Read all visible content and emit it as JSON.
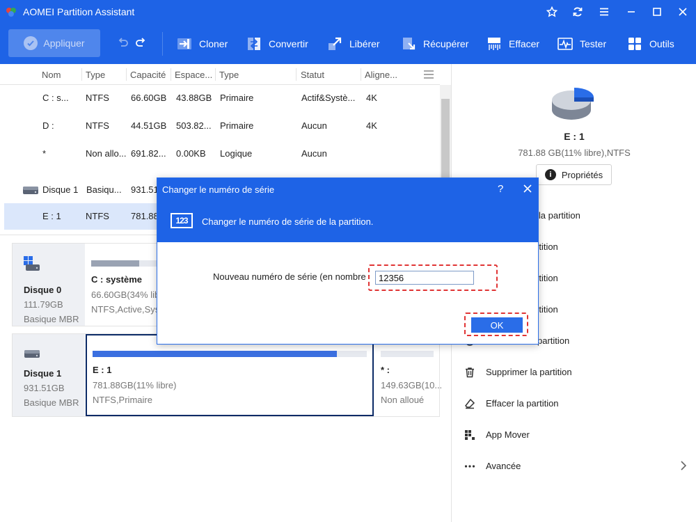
{
  "window": {
    "title": "AOMEI Partition Assistant"
  },
  "toolbar": {
    "apply_label": "Appliquer",
    "tools": [
      {
        "label": "Cloner"
      },
      {
        "label": "Convertir"
      },
      {
        "label": "Libérer"
      },
      {
        "label": "Récupérer"
      },
      {
        "label": "Effacer"
      },
      {
        "label": "Tester"
      },
      {
        "label": "Outils"
      }
    ]
  },
  "table": {
    "headers": [
      "Nom",
      "Type",
      "Capacité",
      "Espace...",
      "Type",
      "Statut",
      "Aligne..."
    ],
    "rows": [
      {
        "name": "C : s...",
        "fs": "NTFS",
        "cap": "66.60GB",
        "free": "43.88GB",
        "type": "Primaire",
        "status": "Actif&Systè...",
        "align": "4K"
      },
      {
        "name": "D :",
        "fs": "NTFS",
        "cap": "44.51GB",
        "free": "503.82...",
        "type": "Primaire",
        "status": "Aucun",
        "align": "4K"
      },
      {
        "name": "*",
        "fs": "Non allo...",
        "cap": "691.82...",
        "free": "0.00KB",
        "type": "Logique",
        "status": "Aucun",
        "align": ""
      },
      {
        "name": "Disque 1",
        "fs": "Basiqu...",
        "cap": "931.51G"
      },
      {
        "name": "E : 1",
        "fs": "NTFS",
        "cap": "781.88"
      }
    ]
  },
  "disks": [
    {
      "name": "Disque 0",
      "size": "111.79GB",
      "type": "Basique MBR",
      "partitions": [
        {
          "name": "C : système",
          "size": "66.60GB(34% lib",
          "fs": "NTFS,Active,Sys"
        }
      ]
    },
    {
      "name": "Disque 1",
      "size": "931.51GB",
      "type": "Basique MBR",
      "partitions": [
        {
          "name": "E : 1",
          "size": "781.88GB(11% libre)",
          "fs": "NTFS,Primaire",
          "used_fraction": 0.89
        },
        {
          "name": "* :",
          "size": "149.63GB(10...",
          "fs": "Non alloué"
        }
      ]
    }
  ],
  "right_panel": {
    "partition_name": "E : 1",
    "partition_info": "781.88 GB(11% libre),NTFS",
    "properties_label": "Propriétés",
    "operations": [
      {
        "label": "ner/déplacer la partition",
        "icon": "resize-icon"
      },
      {
        "label": "rtition",
        "icon": "merge-icon"
      },
      {
        "label": "rtition",
        "icon": "split-icon"
      },
      {
        "label": "rtition",
        "icon": "format-icon"
      },
      {
        "label": "partition",
        "icon": "hide-icon"
      },
      {
        "label": "Supprimer la partition",
        "icon": "trash-icon"
      },
      {
        "label": "Effacer la partition",
        "icon": "eraser-icon"
      },
      {
        "label": "App Mover",
        "icon": "app-mover-icon"
      },
      {
        "label": "Avancée",
        "icon": "more-icon"
      }
    ]
  },
  "dialog": {
    "title": "Changer le numéro de série",
    "help": "?",
    "icon_text": "123",
    "description": "Changer le numéro de série de la partition.",
    "field_label": "Nouveau numéro de série (en nombre",
    "field_value": "12356",
    "ok_label": "OK"
  },
  "colors": {
    "primary": "#1e63e6",
    "highlight": "#e03434",
    "selection": "#dbe7fb"
  }
}
